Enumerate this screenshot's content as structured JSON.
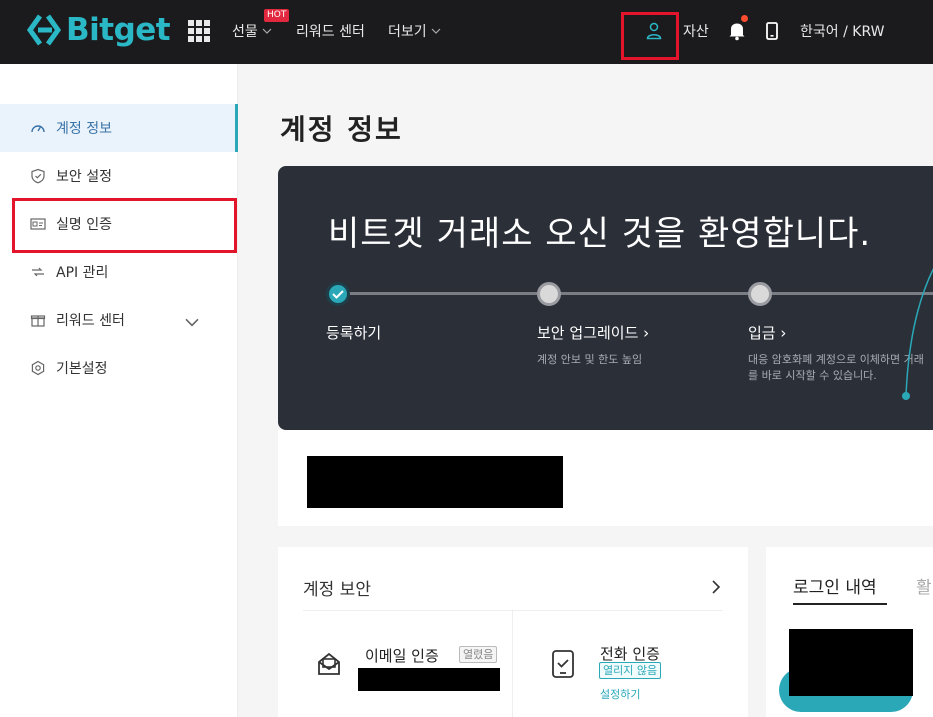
{
  "header": {
    "logo_text": "Bitget",
    "nav": {
      "futures_label": "선물",
      "hot_badge": "HOT",
      "rewards_label": "리워드 센터",
      "more_label": "더보기"
    },
    "assets_label": "자산",
    "language_currency": "한국어 / KRW"
  },
  "sidebar": {
    "items": [
      {
        "label": "계정 정보",
        "icon": "dashboard-icon"
      },
      {
        "label": "보안 설정",
        "icon": "shield-icon"
      },
      {
        "label": "실명 인증",
        "icon": "id-card-icon"
      },
      {
        "label": "API 관리",
        "icon": "api-icon"
      },
      {
        "label": "리워드 센터",
        "icon": "gift-icon"
      },
      {
        "label": "기본설정",
        "icon": "gear-icon"
      }
    ]
  },
  "main": {
    "page_title": "계정 정보",
    "banner": {
      "title": "비트겟 거래소 오신 것을 환영합니다.",
      "steps": [
        {
          "label": "등록하기",
          "sub": ""
        },
        {
          "label": "보안 업그레이드",
          "sub": "계정 안보 및 한도 높임"
        },
        {
          "label": "입금",
          "sub": "대응 암호화폐 계정으로 이체하면 거래를 바로 시작할 수 있습니다."
        }
      ]
    },
    "security": {
      "title": "계정 보안",
      "email": {
        "name": "이메일 인증",
        "status": "열렸음"
      },
      "phone": {
        "name": "전화 인증",
        "status": "열리지 않음",
        "action": "설정하기"
      }
    },
    "login_history": {
      "tab_active": "로그인 내역",
      "tab_other": "활"
    }
  },
  "colors": {
    "accent": "#2aa8b8",
    "topbar": "#1b1b1d",
    "banner": "#2b2f38",
    "highlight": "#e2152b"
  }
}
